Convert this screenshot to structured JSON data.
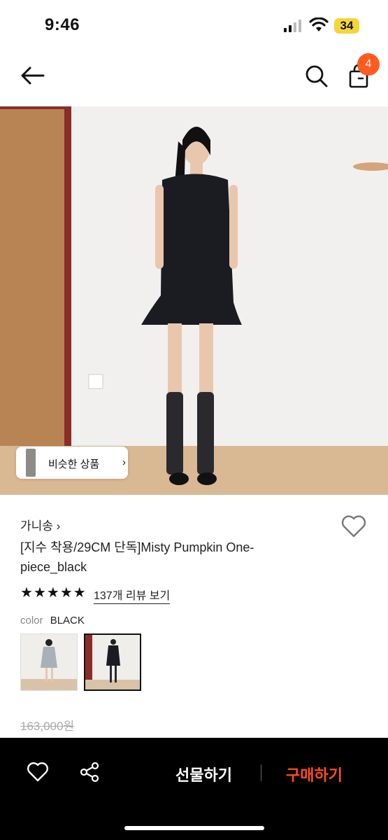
{
  "status_bar": {
    "time": "9:46",
    "battery": "34"
  },
  "nav": {
    "cart_count": "4",
    "icons": [
      "back-arrow-icon",
      "search-icon",
      "shopping-bag-icon"
    ]
  },
  "hero": {
    "similar_label": "비슷한 상품",
    "similar_chevron": "›"
  },
  "product": {
    "brand": "가니송 ›",
    "title": "[지수 착용/29CM 단독]Misty Pumpkin One-piece_black",
    "rating_stars": 5,
    "review_link": "137개 리뷰 보기",
    "color_key": "color",
    "color_value": "BLACK",
    "price_original": "163,000원"
  },
  "bottom_bar": {
    "gift_label": "선물하기",
    "buy_label": "구매하기"
  },
  "colors": {
    "accent": "#ff5a1f",
    "buy": "#ff4d1a",
    "battery": "#f5d63a"
  }
}
